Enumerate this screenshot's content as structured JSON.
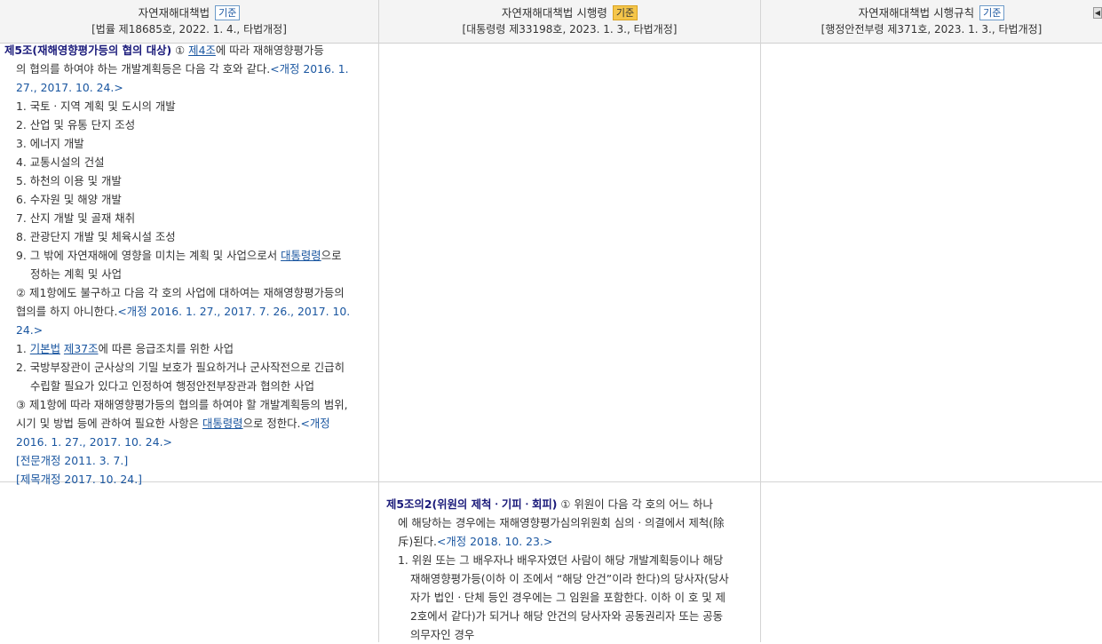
{
  "headers": [
    {
      "title": "자연재해대책법",
      "badge": "기준",
      "sub": "[법률 제18685호, 2022. 1. 4., 타법개정]"
    },
    {
      "title": "자연재해대책법 시행령",
      "badge": "기준",
      "sub": "[대통령령 제33198호, 2023. 1. 3., 타법개정]"
    },
    {
      "title": "자연재해대책법 시행규칙",
      "badge": "기준",
      "sub": "[행정안전부령 제371호, 2023. 1. 3., 타법개정]"
    }
  ],
  "scroll_btn": "◀",
  "law": {
    "art_title": "제5조(재해영향평가등의 협의 대상)",
    "p1_a": " ① ",
    "p1_link": "제4조",
    "p1_b": "에 따라 재해영향평가등",
    "p1_c": "의 협의를 하여야 하는 개발계획등은 다음 각 호와 같다.",
    "p1_rev1": "<개정 2016. 1.",
    "p1_rev2": "27., 2017. 10. 24.>",
    "items1": [
      "1. 국토ㆍ지역 계획 및 도시의 개발",
      "2. 산업 및 유통 단지 조성",
      "3. 에너지 개발",
      "4. 교통시설의 건설",
      "5. 하천의 이용 및 개발",
      "6. 수자원 및 해양 개발",
      "7. 산지 개발 및 골재 채취",
      "8. 관광단지 개발 및 체육시설 조성"
    ],
    "item9_a": "9. 그 밖에 자연재해에 영향을 미치는 계획 및 사업으로서 ",
    "item9_link": "대통령령",
    "item9_b": "으로",
    "item9_c": "정하는 계획 및 사업",
    "p2_a": "② 제1항에도 불구하고 다음 각 호의 사업에 대하여는 재해영향평가등의",
    "p2_b": "협의를 하지 아니한다.",
    "p2_rev": "<개정 2016. 1. 27., 2017. 7. 26., 2017. 10. 24.>",
    "p2i1_num": "1. ",
    "p2i1_link1": "기본법",
    "p2i1_sp": " ",
    "p2i1_link2": "제37조",
    "p2i1_b": "에 따른 응급조치를 위한 사업",
    "p2i2_a": "2. 국방부장관이 군사상의 기밀 보호가 필요하거나 군사작전으로 긴급히",
    "p2i2_b": "수립할 필요가 있다고 인정하여 행정안전부장관과 협의한 사업",
    "p3_a": "③ 제1항에 따라 재해영향평가등의 협의를 하여야 할 개발계획등의 범위,",
    "p3_b": "시기 및 방법 등에 관하여 필요한 사항은 ",
    "p3_link": "대통령령",
    "p3_c": "으로 정한다.",
    "p3_rev1": "<개정",
    "p3_rev2": "2016. 1. 27., 2017. 10. 24.>",
    "note1": "[전문개정 2011. 3. 7.]",
    "note2": "[제목개정 2017. 10. 24.]"
  },
  "decree": {
    "art_title": "제5조의2(위원의 제척ㆍ기피ㆍ회피)",
    "p1_a": " ① 위원이 다음 각 호의 어느 하나",
    "p1_b": "에 해당하는 경우에는 재해영향평가심의위원회 심의ㆍ의결에서 제척(除",
    "p1_c": "斥)된다.",
    "p1_rev": "<개정 2018. 10. 23.>",
    "i1_l1": "1. 위원 또는 그 배우자나 배우자였던 사람이 해당 개발계획등이나 해당",
    "i1_l2": "재해영향평가등(이하 이 조에서 “해당 안건”이라 한다)의 당사자(당사",
    "i1_l3": "자가 법인ㆍ단체 등인 경우에는 그 임원을 포함한다. 이하 이 호 및 제",
    "i1_l4": "2호에서 같다)가 되거나 해당 안건의 당사자와 공동권리자 또는 공동",
    "i1_l5": "의무자인 경우"
  }
}
